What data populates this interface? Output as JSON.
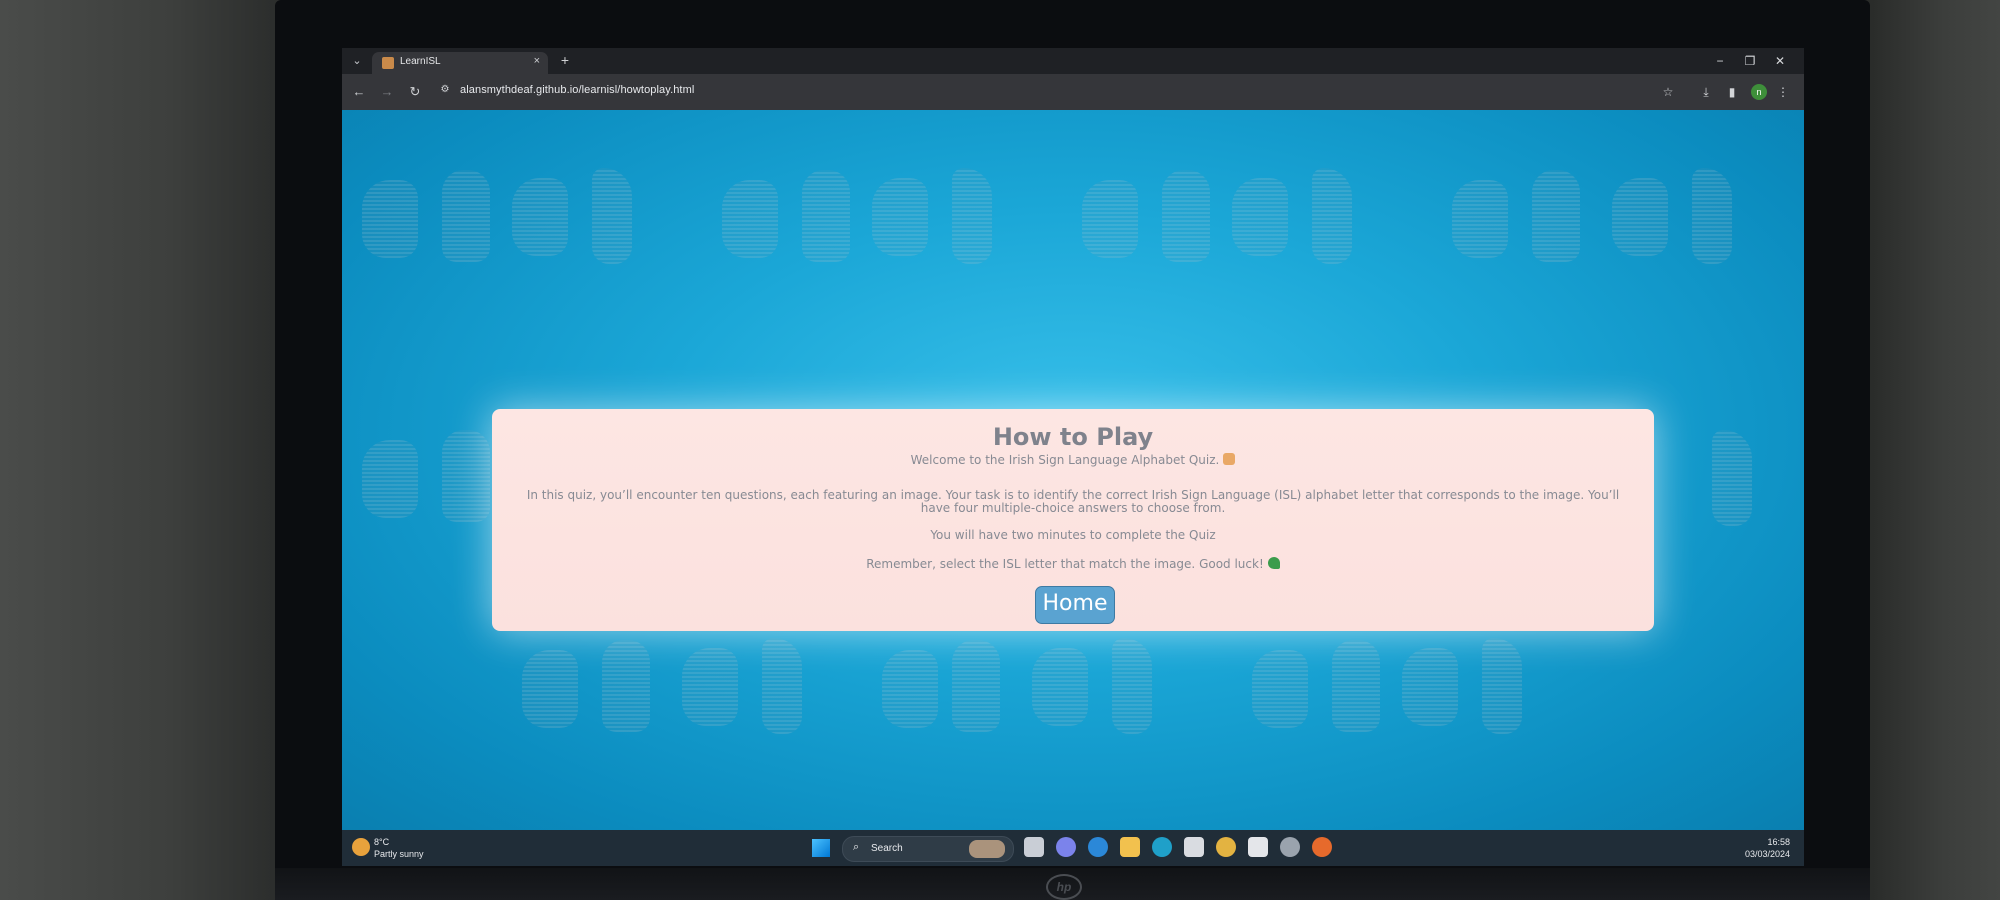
{
  "browser": {
    "tab_title": "LearnISL",
    "tab_close": "×",
    "new_tab": "+",
    "url": "alansmythdeaf.github.io/learnisl/howtoplay.html",
    "window_controls": {
      "minimize": "−",
      "restore": "❐",
      "close": "✕"
    },
    "nav": {
      "back": "←",
      "forward": "→",
      "reload": "↻"
    },
    "profile_initial": "n"
  },
  "page": {
    "title": "How to Play",
    "welcome": "Welcome to the Irish Sign Language Alphabet Quiz.",
    "description": "In this quiz, you’ll encounter ten questions, each featuring an image. Your task is to identify the correct Irish Sign Language (ISL) alphabet letter that corresponds to the image. You’ll have four multiple-choice answers to choose from.",
    "time_limit": "You will have two minutes to complete the Quiz",
    "reminder": "Remember, select the ISL letter that match the image. Good luck!",
    "home_button": "Home"
  },
  "taskbar": {
    "temperature": "8°C",
    "weather": "Partly sunny",
    "search_label": "Search",
    "time": "16:58",
    "date": "03/03/2024"
  },
  "monitor": {
    "brand": "hp"
  }
}
